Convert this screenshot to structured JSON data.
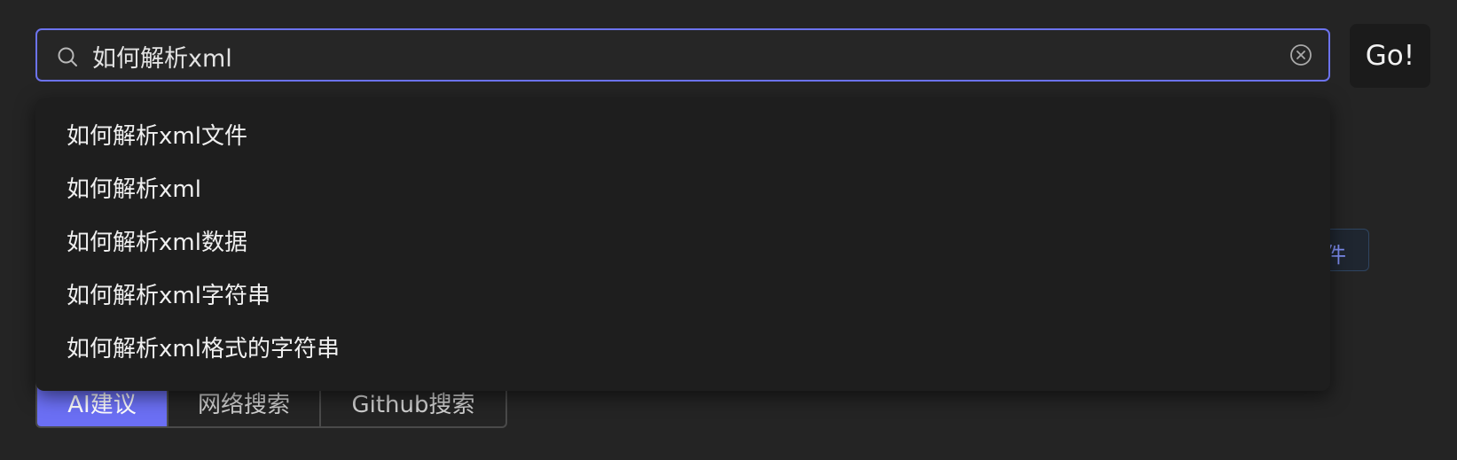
{
  "search": {
    "value": "如何解析xml",
    "placeholder": ""
  },
  "go_button": {
    "label": "Go!"
  },
  "suggestions": [
    "如何解析xml文件",
    "如何解析xml",
    "如何解析xml数据",
    "如何解析xml字符串",
    "如何解析xml格式的字符串"
  ],
  "background_chip": {
    "visible_text": "件"
  },
  "tabs": [
    {
      "label": "AI建议",
      "active": true
    },
    {
      "label": "网络搜索",
      "active": false
    },
    {
      "label": "Github搜索",
      "active": false
    }
  ],
  "colors": {
    "accent": "#6b6ff4",
    "focus_border": "#6c73ee",
    "background": "#242424",
    "dropdown": "#1e1e1e",
    "go_button": "#1b1b1b"
  },
  "icons": {
    "search": "search-icon",
    "clear": "clear-icon"
  }
}
